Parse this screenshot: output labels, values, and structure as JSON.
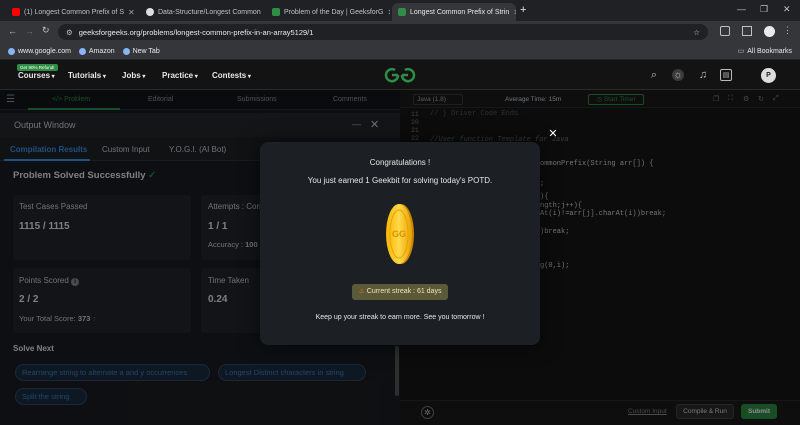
{
  "browser": {
    "tabs": [
      {
        "title": "(1) Longest Common Prefix of S",
        "color": "#ff0000"
      },
      {
        "title": "Data-Structure/Longest Common",
        "color": "#ffffff"
      },
      {
        "title": "Problem of the Day | GeeksforG",
        "color": "#2f8d46"
      },
      {
        "title": "Longest Common Prefix of Strin",
        "color": "#2f8d46"
      }
    ],
    "new_tab": "+",
    "url": "geeksforgeeks.org/problems/longest-common-prefix-in-an-array5129/1",
    "bookmarks": [
      "www.google.com",
      "Amazon",
      "New Tab"
    ],
    "all_bookmarks": "All Bookmarks"
  },
  "gfg_nav": {
    "promo": "Get 90% Refund!",
    "items": [
      "Courses",
      "Tutorials",
      "Jobs",
      "Practice",
      "Contests"
    ],
    "avatar_letter": "P"
  },
  "left_tabs": [
    "</> Problem",
    "Editorial",
    "Submissions",
    "Comments"
  ],
  "output": {
    "title": "Output Window",
    "minimize": "—",
    "close": "✕",
    "tabs": [
      "Compilation Results",
      "Custom Input",
      "Y.O.G.I. (AI Bot)"
    ],
    "status": "Problem Solved Successfully",
    "cards": {
      "test_label": "Test Cases Passed",
      "test_value": "1115 / 1115",
      "attempts_label": "Attempts : Corr",
      "attempts_value": "1 / 1",
      "accuracy_label": "Accuracy :",
      "accuracy_value": "100",
      "points_label": "Points Scored",
      "points_value": "2 / 2",
      "total_label": "Your Total Score:",
      "total_value": "373",
      "time_label": "Time Taken",
      "time_value": "0.24"
    },
    "solve_next": "Solve Next",
    "chips": [
      "Rearrange string to alternate a and y occurrences",
      "Longest Distinct characters in string",
      "Split the string"
    ]
  },
  "editor": {
    "language": "Java (1.8)",
    "avg_time": "Average Time: 15m",
    "start_timer": "Start Timer",
    "lines": [
      {
        "n": "11",
        "code": ""
      },
      {
        "n": "20",
        "code": "// } Driver Code Ends"
      },
      {
        "n": "21",
        "code": ""
      },
      {
        "n": "22",
        "code": "//User function Template for Java"
      },
      {
        "n": "",
        "code": "ommonPrefix(String arr[]) {"
      },
      {
        "n": "",
        "code": ";"
      },
      {
        "n": "",
        "code": "){"
      },
      {
        "n": "",
        "code": "ngth;j++){"
      },
      {
        "n": "",
        "code": "At(i)!=arr[j].charAt(i))break;"
      },
      {
        "n": "",
        "code": ")break;"
      },
      {
        "n": "",
        "code": "g(0,i);"
      }
    ],
    "custom_input": "Custom Input",
    "compile": "Compile & Run",
    "submit": "Submit"
  },
  "modal": {
    "title": "Congratulations !",
    "message": "You just earned 1 Geekbit for solving today's POTD.",
    "streak": "Current streak : 61 days",
    "footer": "Keep up your streak to earn more. See you tomorrow !",
    "close": "✕"
  },
  "colors": {
    "brand": "#2f8d46",
    "accent": "#3c93e8"
  }
}
